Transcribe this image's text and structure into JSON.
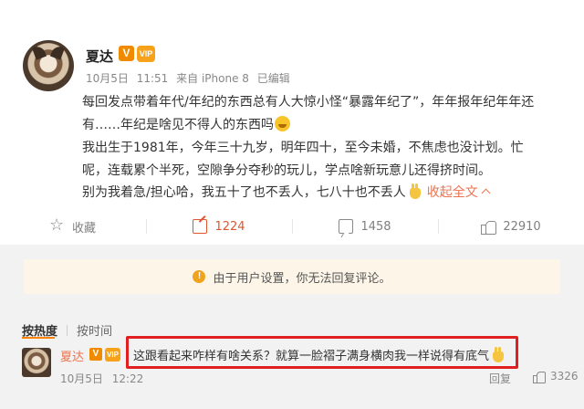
{
  "post": {
    "author": "夏达",
    "verified_badge": "V",
    "member_badge": "🐮",
    "date": "10月5日",
    "time": "11:51",
    "source": "来自 iPhone 8",
    "edited": "已编辑",
    "lines": [
      "每回发点带着年代/年纪的东西总有人大惊小怪“暴露年纪了”，年年报年纪年年还",
      "有……年纪是啥见不得人的东西吗",
      "我出生于1981年，今年三十九岁，明年四十，至今未婚，不焦虑也没计划。忙",
      "呢，连载累个半死，空隙争分夺秒的玩儿，学点啥新玩意儿还得挤时间。",
      "别为我着急/担心哈，我五十了也不丢人，七八十也不丢人"
    ],
    "collapse_label": "收起全文"
  },
  "actions": {
    "favorite": "收藏",
    "share_count": "1224",
    "comment_count": "1458",
    "like_count": "22910"
  },
  "notice": {
    "icon": "!",
    "text": "由于用户设置，你无法回复评论。"
  },
  "sort": {
    "hot": "按热度",
    "time": "按时间"
  },
  "comment": {
    "author": "夏达",
    "verified_badge": "V",
    "text": "这跟看起来咋样有啥关系？就算一脸褶子满身横肉我一样说得有底气",
    "date": "10月5日",
    "time": "12:22",
    "reply": "回复",
    "like_count": "3326"
  },
  "colors": {
    "accent": "#eb7350",
    "highlight_border": "#e02020",
    "notice_bg": "#fdf6e8",
    "sort_underline": "#ff8200"
  }
}
